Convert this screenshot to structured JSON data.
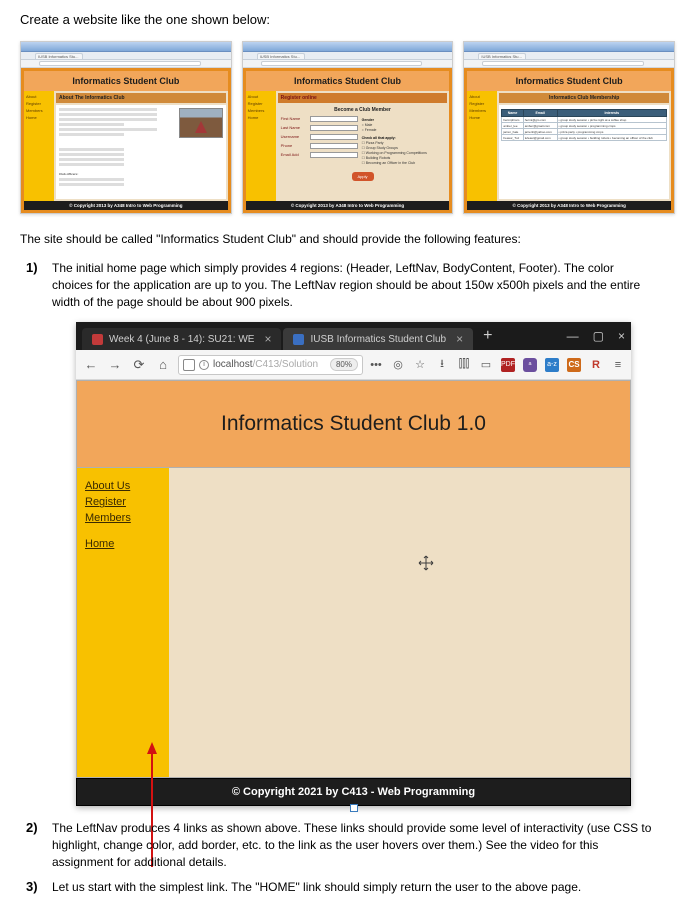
{
  "instr": {
    "heading": "Create a website like the one shown below:",
    "sub": "The site should be called \"Informatics Student Club\" and should provide the following features:",
    "items": [
      {
        "num": "1)",
        "text": "The initial home page which simply provides 4 regions: (Header, LeftNav, BodyContent, Footer). The color choices for the application are up to you. The LeftNav region should be about 150w x500h pixels and the entire width of the page should be about 900 pixels."
      },
      {
        "num": "2)",
        "text": "The LeftNav produces 4 links as shown above. These links should provide some level of interactivity (use CSS to highlight, change color, add border, etc. to the link as the user hovers over them.) See the video for this assignment for additional details."
      },
      {
        "num": "3)",
        "text": "Let us start with the simplest link. The \"HOME\" link should simply return the user to the above page."
      }
    ]
  },
  "thumbs": {
    "header_title": "Informatics Student Club",
    "tab_label": "IUSB Informatics Stu...",
    "nav": [
      "About",
      "Register",
      "Members",
      "Home"
    ],
    "footer": "© Copyright 2013 by A348 Intro to Web Programming",
    "about": {
      "bar": "About The Informatics Club",
      "section_officers": "Club officers:"
    },
    "register": {
      "bar": "Register online",
      "subtitle": "Become a Club Member",
      "fields": [
        "First Name",
        "Last Name",
        "Username",
        "Phone",
        "Email Add"
      ],
      "gender_label": "Gender",
      "gender_opts": [
        "Male",
        "Female"
      ],
      "check_label": "Check all that apply:",
      "checks": [
        "Pizza Party",
        "Group Study Groups",
        "Working on Programming Competitions",
        "Building Robots",
        "Becoming an Officer in the Club"
      ],
      "apply": "Apply"
    },
    "members": {
      "bar": "Informatics Club Membership",
      "cols": [
        "Name",
        "Email",
        "Interests"
      ],
      "rows": [
        [
          "hermiphram",
          "hermi@gm.com",
          "• group study session\n• pizza night at a coffee shop"
        ],
        [
          "amber_lee",
          "amber@gmail.com",
          "• group study session\n• programming cmps"
        ],
        [
          "jarren_hale",
          "jarrenh@yahoo.com",
          "• pizza party\n• programming cmps"
        ],
        [
          "Feasur_Tuz",
          "tufeasr@gmail.com",
          "• group study session\n• building robots\n• becoming an officer of the club"
        ]
      ]
    }
  },
  "browser": {
    "tabs": [
      {
        "label": "Week 4 (June 8 - 14): SU21: WE",
        "active": false
      },
      {
        "label": "IUSB Informatics Student Club",
        "active": true
      }
    ],
    "newtab": "+",
    "win_min": "—",
    "win_max": "▢",
    "win_close": "×",
    "nav_back": "←",
    "nav_fwd": "→",
    "nav_reload": "⟳",
    "nav_home": "⌂",
    "http_info": "i",
    "url_host": "localhost",
    "url_path": "/C413/Solution",
    "zoom": "80%",
    "ellipsis": "•••",
    "reader": "◎",
    "star": "☆",
    "download": "⭳",
    "library": "⫿⫿⫿",
    "container": "▭",
    "ext_pdf": "PDF",
    "ext_ab": "ᵃ",
    "ext_az": "a-z",
    "ext_cs": "CS",
    "ext_r": "R",
    "menu": "≡"
  },
  "page": {
    "header": "Informatics Student Club 1.0",
    "nav": {
      "about": "About Us",
      "register": "Register",
      "members": "Members",
      "home": "Home"
    },
    "footer": "© Copyright 2021 by C413 - Web Programming"
  }
}
